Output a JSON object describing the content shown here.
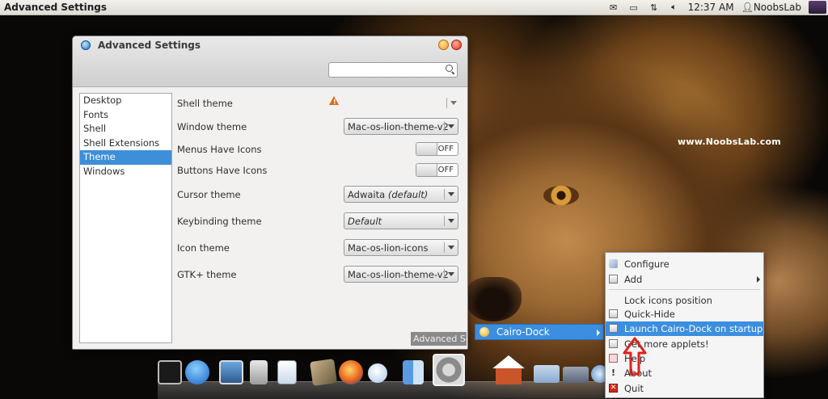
{
  "top_panel": {
    "active_app": "Advanced Settings",
    "clock": "12:37 AM",
    "user": "NoobsLab",
    "tray_icons": [
      "mail-icon",
      "battery-icon",
      "network-icon",
      "volume-icon"
    ]
  },
  "desktop": {
    "watermark": "www.NoobsLab.com"
  },
  "window": {
    "title": "Advanced Settings",
    "search_placeholder": "",
    "sidebar": {
      "items": [
        "Desktop",
        "Fonts",
        "Shell",
        "Shell Extensions",
        "Theme",
        "Windows"
      ],
      "selected": "Theme"
    },
    "settings": [
      {
        "label": "Shell theme",
        "type": "combo-warning",
        "value": ""
      },
      {
        "label": "Window theme",
        "type": "combo",
        "value": "Mac-os-lion-theme-v2"
      },
      {
        "label": "Menus Have Icons",
        "type": "toggle",
        "value": "OFF"
      },
      {
        "label": "Buttons Have Icons",
        "type": "toggle",
        "value": "OFF"
      },
      {
        "label": "Cursor theme",
        "type": "combo",
        "value": "Adwaita",
        "value_suffix": "(default)"
      },
      {
        "label": "Keybinding theme",
        "type": "combo",
        "value": "Default"
      },
      {
        "label": "Icon theme",
        "type": "combo",
        "value": "Mac-os-lion-icons"
      },
      {
        "label": "GTK+ theme",
        "type": "combo",
        "value": "Mac-os-lion-theme-v2"
      }
    ]
  },
  "dock_tooltip": "Advanced Settings",
  "dock_menu": {
    "label": "Cairo-Dock"
  },
  "context_menu": {
    "items": [
      {
        "label": "Configure",
        "icon": "wrench-icon",
        "submenu": false
      },
      {
        "label": "Add",
        "icon": "add-icon",
        "submenu": true
      },
      {
        "label": "Lock icons position",
        "icon": "",
        "submenu": false
      },
      {
        "label": "Quick-Hide",
        "icon": "hide-icon",
        "submenu": false
      },
      {
        "label": "Launch Cairo-Dock on startup",
        "icon": "add-icon",
        "submenu": false
      },
      {
        "label": "Get more applets!",
        "icon": "add-icon",
        "submenu": false
      },
      {
        "label": "Help",
        "icon": "help-icon",
        "submenu": false
      },
      {
        "label": "About",
        "icon": "info-icon",
        "submenu": false
      },
      {
        "label": "Quit",
        "icon": "quit-icon",
        "submenu": false
      }
    ]
  },
  "dock": {
    "icons": [
      "terminal-icon",
      "app-store-icon",
      "photos-icon",
      "calculator-icon",
      "preview-icon",
      "stamp-icon",
      "firefox-icon",
      "chat-icon",
      "finder-icon",
      "settings-icon",
      "home-icon",
      "documents-folder-icon",
      "folder-icon",
      "search-icon"
    ]
  },
  "colors": {
    "selection": "#3e8fd9",
    "annotation_arrow": "#e0201a"
  }
}
